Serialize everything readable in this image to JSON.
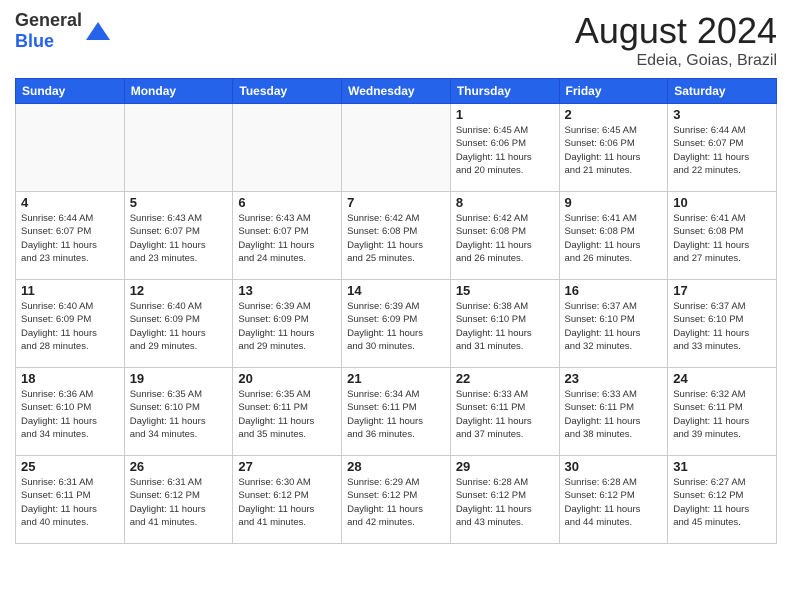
{
  "logo": {
    "general": "General",
    "blue": "Blue"
  },
  "title": "August 2024",
  "location": "Edeia, Goias, Brazil",
  "days_of_week": [
    "Sunday",
    "Monday",
    "Tuesday",
    "Wednesday",
    "Thursday",
    "Friday",
    "Saturday"
  ],
  "weeks": [
    [
      {
        "day": "",
        "info": ""
      },
      {
        "day": "",
        "info": ""
      },
      {
        "day": "",
        "info": ""
      },
      {
        "day": "",
        "info": ""
      },
      {
        "day": "1",
        "info": "Sunrise: 6:45 AM\nSunset: 6:06 PM\nDaylight: 11 hours\nand 20 minutes."
      },
      {
        "day": "2",
        "info": "Sunrise: 6:45 AM\nSunset: 6:06 PM\nDaylight: 11 hours\nand 21 minutes."
      },
      {
        "day": "3",
        "info": "Sunrise: 6:44 AM\nSunset: 6:07 PM\nDaylight: 11 hours\nand 22 minutes."
      }
    ],
    [
      {
        "day": "4",
        "info": "Sunrise: 6:44 AM\nSunset: 6:07 PM\nDaylight: 11 hours\nand 23 minutes."
      },
      {
        "day": "5",
        "info": "Sunrise: 6:43 AM\nSunset: 6:07 PM\nDaylight: 11 hours\nand 23 minutes."
      },
      {
        "day": "6",
        "info": "Sunrise: 6:43 AM\nSunset: 6:07 PM\nDaylight: 11 hours\nand 24 minutes."
      },
      {
        "day": "7",
        "info": "Sunrise: 6:42 AM\nSunset: 6:08 PM\nDaylight: 11 hours\nand 25 minutes."
      },
      {
        "day": "8",
        "info": "Sunrise: 6:42 AM\nSunset: 6:08 PM\nDaylight: 11 hours\nand 26 minutes."
      },
      {
        "day": "9",
        "info": "Sunrise: 6:41 AM\nSunset: 6:08 PM\nDaylight: 11 hours\nand 26 minutes."
      },
      {
        "day": "10",
        "info": "Sunrise: 6:41 AM\nSunset: 6:08 PM\nDaylight: 11 hours\nand 27 minutes."
      }
    ],
    [
      {
        "day": "11",
        "info": "Sunrise: 6:40 AM\nSunset: 6:09 PM\nDaylight: 11 hours\nand 28 minutes."
      },
      {
        "day": "12",
        "info": "Sunrise: 6:40 AM\nSunset: 6:09 PM\nDaylight: 11 hours\nand 29 minutes."
      },
      {
        "day": "13",
        "info": "Sunrise: 6:39 AM\nSunset: 6:09 PM\nDaylight: 11 hours\nand 29 minutes."
      },
      {
        "day": "14",
        "info": "Sunrise: 6:39 AM\nSunset: 6:09 PM\nDaylight: 11 hours\nand 30 minutes."
      },
      {
        "day": "15",
        "info": "Sunrise: 6:38 AM\nSunset: 6:10 PM\nDaylight: 11 hours\nand 31 minutes."
      },
      {
        "day": "16",
        "info": "Sunrise: 6:37 AM\nSunset: 6:10 PM\nDaylight: 11 hours\nand 32 minutes."
      },
      {
        "day": "17",
        "info": "Sunrise: 6:37 AM\nSunset: 6:10 PM\nDaylight: 11 hours\nand 33 minutes."
      }
    ],
    [
      {
        "day": "18",
        "info": "Sunrise: 6:36 AM\nSunset: 6:10 PM\nDaylight: 11 hours\nand 34 minutes."
      },
      {
        "day": "19",
        "info": "Sunrise: 6:35 AM\nSunset: 6:10 PM\nDaylight: 11 hours\nand 34 minutes."
      },
      {
        "day": "20",
        "info": "Sunrise: 6:35 AM\nSunset: 6:11 PM\nDaylight: 11 hours\nand 35 minutes."
      },
      {
        "day": "21",
        "info": "Sunrise: 6:34 AM\nSunset: 6:11 PM\nDaylight: 11 hours\nand 36 minutes."
      },
      {
        "day": "22",
        "info": "Sunrise: 6:33 AM\nSunset: 6:11 PM\nDaylight: 11 hours\nand 37 minutes."
      },
      {
        "day": "23",
        "info": "Sunrise: 6:33 AM\nSunset: 6:11 PM\nDaylight: 11 hours\nand 38 minutes."
      },
      {
        "day": "24",
        "info": "Sunrise: 6:32 AM\nSunset: 6:11 PM\nDaylight: 11 hours\nand 39 minutes."
      }
    ],
    [
      {
        "day": "25",
        "info": "Sunrise: 6:31 AM\nSunset: 6:11 PM\nDaylight: 11 hours\nand 40 minutes."
      },
      {
        "day": "26",
        "info": "Sunrise: 6:31 AM\nSunset: 6:12 PM\nDaylight: 11 hours\nand 41 minutes."
      },
      {
        "day": "27",
        "info": "Sunrise: 6:30 AM\nSunset: 6:12 PM\nDaylight: 11 hours\nand 41 minutes."
      },
      {
        "day": "28",
        "info": "Sunrise: 6:29 AM\nSunset: 6:12 PM\nDaylight: 11 hours\nand 42 minutes."
      },
      {
        "day": "29",
        "info": "Sunrise: 6:28 AM\nSunset: 6:12 PM\nDaylight: 11 hours\nand 43 minutes."
      },
      {
        "day": "30",
        "info": "Sunrise: 6:28 AM\nSunset: 6:12 PM\nDaylight: 11 hours\nand 44 minutes."
      },
      {
        "day": "31",
        "info": "Sunrise: 6:27 AM\nSunset: 6:12 PM\nDaylight: 11 hours\nand 45 minutes."
      }
    ]
  ]
}
